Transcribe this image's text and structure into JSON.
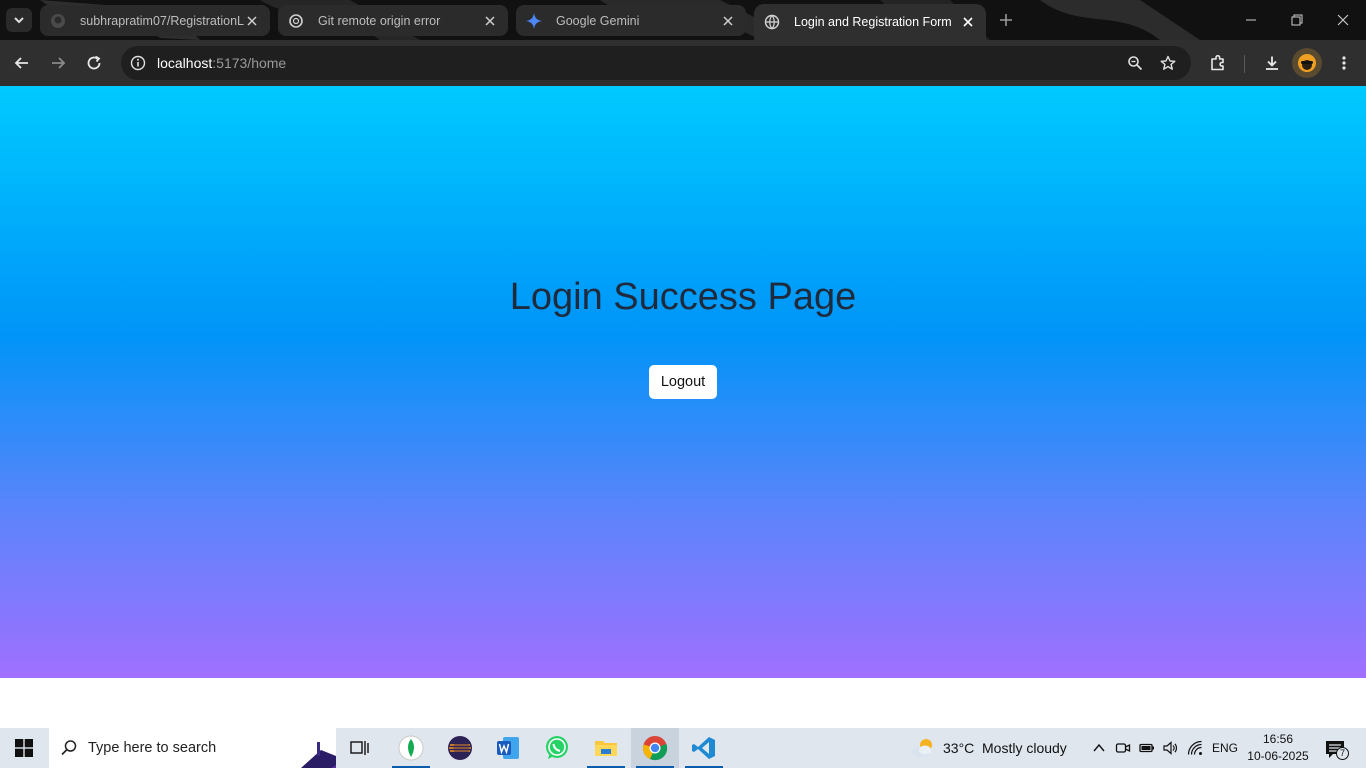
{
  "browser": {
    "tabs": [
      {
        "title": "subhrapratim07/RegistrationLo",
        "favicon": "github-icon",
        "active": false
      },
      {
        "title": "Git remote origin error",
        "favicon": "chatgpt-icon",
        "active": false
      },
      {
        "title": "Google Gemini",
        "favicon": "gemini-icon",
        "active": false
      },
      {
        "title": "Login and Registration Form",
        "favicon": "globe-icon",
        "active": true
      }
    ],
    "address_bar": {
      "host": "localhost",
      "path": ":5173/home"
    }
  },
  "page": {
    "heading": "Login Success Page",
    "logout_label": "Logout",
    "colors": {
      "gradient_top": "#00caff",
      "gradient_mid": "#0094f8",
      "gradient_bottom": "#a070ff",
      "heading": "#1f2b3d"
    }
  },
  "taskbar": {
    "search_placeholder": "Type here to search",
    "apps": [
      "mongodb-compass-icon",
      "eclipse-icon",
      "word-icon",
      "whatsapp-icon",
      "file-explorer-icon",
      "chrome-icon",
      "vscode-icon"
    ],
    "weather": {
      "temp": "33°C",
      "condition": "Mostly cloudy"
    },
    "language": "ENG",
    "time": "16:56",
    "date": "10-06-2025",
    "notification_count": "7"
  }
}
